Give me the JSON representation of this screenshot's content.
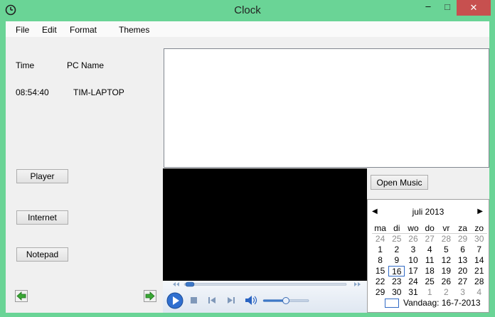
{
  "window": {
    "title": "Clock",
    "controls": {
      "minimize": "–",
      "maximize": "□",
      "close": "✕"
    },
    "icon": "clock-icon"
  },
  "menu": [
    "File",
    "Edit",
    "Format",
    "Themes"
  ],
  "info": {
    "time_header": "Time",
    "pc_header": "PC Name",
    "time_value": "08:54:40",
    "pc_value": "TIM-LAPTOP"
  },
  "buttons": {
    "player": "Player",
    "internet": "Internet",
    "notepad": "Notepad",
    "open_music": "Open Music"
  },
  "nav": {
    "back_icon": "arrow-left-icon",
    "forward_icon": "arrow-right-icon"
  },
  "media_player": {
    "icons": [
      "play-icon",
      "stop-icon",
      "previous-icon",
      "next-icon",
      "volume-icon"
    ],
    "progress": 0.02,
    "volume": 0.5
  },
  "calendar": {
    "month_label": "juli 2013",
    "prev": "◀",
    "next": "▶",
    "days_of_week": [
      "ma",
      "di",
      "wo",
      "do",
      "vr",
      "za",
      "zo"
    ],
    "weeks": [
      [
        "24",
        "25",
        "26",
        "27",
        "28",
        "29",
        "30"
      ],
      [
        "1",
        "2",
        "3",
        "4",
        "5",
        "6",
        "7"
      ],
      [
        "8",
        "9",
        "10",
        "11",
        "12",
        "13",
        "14"
      ],
      [
        "15",
        "16",
        "17",
        "18",
        "19",
        "20",
        "21"
      ],
      [
        "22",
        "23",
        "24",
        "25",
        "26",
        "27",
        "28"
      ],
      [
        "29",
        "30",
        "31",
        "1",
        "2",
        "3",
        "4"
      ]
    ],
    "today_label": "Vandaag: 16-7-2013",
    "today": "16"
  },
  "colors": {
    "accent": "#6ad496",
    "close": "#c7504f",
    "selection": "#316ac5"
  }
}
